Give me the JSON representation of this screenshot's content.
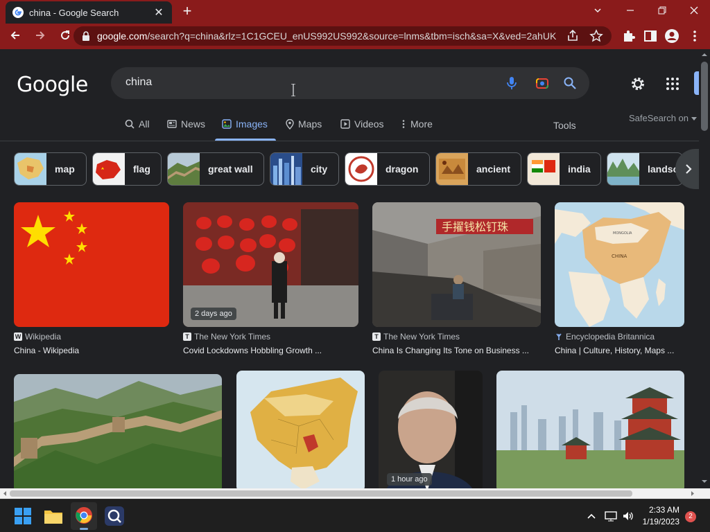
{
  "browser": {
    "tab_title": "china - Google Search",
    "tab_close": "✕",
    "new_tab": "+",
    "url_host": "google.com",
    "url_rest": "/search?q=china&rlz=1C1GCEU_enUS992US992&source=lnms&tbm=isch&sa=X&ved=2ahUK..."
  },
  "google": {
    "logo": "Google",
    "query": "china",
    "safesearch": "SafeSearch on",
    "tools": "Tools",
    "tabs": [
      {
        "label": "All",
        "icon": "search-icon"
      },
      {
        "label": "News",
        "icon": "news-icon"
      },
      {
        "label": "Images",
        "icon": "image-icon",
        "active": true
      },
      {
        "label": "Maps",
        "icon": "pin-icon"
      },
      {
        "label": "Videos",
        "icon": "play-icon"
      },
      {
        "label": "More",
        "icon": "kebab-icon"
      }
    ],
    "chips": [
      "map",
      "flag",
      "great wall",
      "city",
      "dragon",
      "ancient",
      "india",
      "landsc"
    ]
  },
  "results": [
    {
      "source": "Wikipedia",
      "source_icon": "W",
      "title": "China - Wikipedia",
      "badge": ""
    },
    {
      "source": "The New York Times",
      "source_icon": "T",
      "title": "Covid Lockdowns Hobbling Growth ...",
      "badge": "2 days ago"
    },
    {
      "source": "The New York Times",
      "source_icon": "T",
      "title": "China Is Changing Its Tone on Business ...",
      "badge": ""
    },
    {
      "source": "Encyclopedia Britannica",
      "source_icon": "B",
      "title": "China | Culture, History, Maps ...",
      "badge": ""
    },
    {
      "source": "",
      "title": "",
      "badge": ""
    },
    {
      "source": "",
      "title": "",
      "badge": ""
    },
    {
      "source": "",
      "title": "",
      "badge": "1 hour ago"
    },
    {
      "source": "",
      "title": "",
      "badge": ""
    }
  ],
  "map_labels": {
    "center": "CHINA",
    "mongolia": "MONGOLIA"
  },
  "taskbar": {
    "time": "2:33 AM",
    "date": "1/19/2023",
    "notifications": "2"
  },
  "colors": {
    "frame": "#8a1b1b",
    "accent": "#8ab4f8",
    "page_bg": "#202124"
  }
}
